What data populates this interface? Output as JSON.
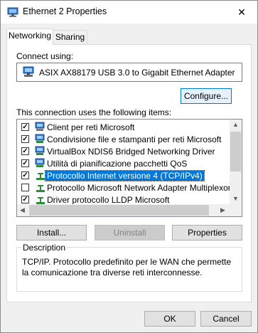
{
  "window": {
    "title": "Ethernet 2 Properties",
    "close_symbol": "✕"
  },
  "tabs": [
    {
      "label": "Networking"
    },
    {
      "label": "Sharing"
    }
  ],
  "connect": {
    "label": "Connect using:",
    "adapter": "ASIX AX88179 USB 3.0 to Gigabit Ethernet Adapter",
    "configure_label": "Configure..."
  },
  "items": {
    "label": "This connection uses the following items:",
    "list": [
      {
        "label": "Client per reti Microsoft",
        "checked": true,
        "icon": "network-client-icon"
      },
      {
        "label": "Condivisione file e stampanti per reti Microsoft",
        "checked": true,
        "icon": "network-service-icon"
      },
      {
        "label": "VirtualBox NDIS6 Bridged Networking Driver",
        "checked": true,
        "icon": "network-service-icon"
      },
      {
        "label": "Utilità di pianificazione pacchetti QoS",
        "checked": true,
        "icon": "network-service-icon"
      },
      {
        "label": "Protocollo Internet versione 4 (TCP/IPv4)",
        "checked": true,
        "icon": "protocol-icon",
        "selected": true
      },
      {
        "label": "Protocollo Microsoft Network Adapter Multiplexor",
        "checked": false,
        "icon": "protocol-icon"
      },
      {
        "label": "Driver protocollo LLDP Microsoft",
        "checked": true,
        "icon": "protocol-icon"
      }
    ]
  },
  "actions": {
    "install": "Install...",
    "uninstall": "Uninstall",
    "properties": "Properties"
  },
  "description": {
    "legend": "Description",
    "text": "TCP/IP. Protocollo predefinito per le WAN che permette la comunicazione tra diverse reti interconnesse."
  },
  "footer": {
    "ok": "OK",
    "cancel": "Cancel"
  },
  "colors": {
    "selection": "#0078d7",
    "dialog_bg": "#f0f0f0"
  }
}
